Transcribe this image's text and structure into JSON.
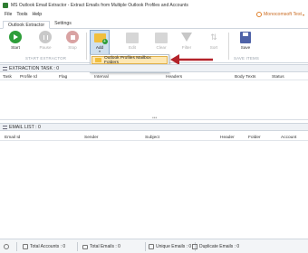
{
  "window": {
    "title": "MS Outlook Email Extractor - Extract Emails from Multiple Outlook Profiles and Accounts"
  },
  "menu": {
    "items": [
      "File",
      "Tools",
      "Help"
    ]
  },
  "account": {
    "label": "Monocomsoft Test",
    "icon": "user-icon"
  },
  "tabs": [
    "Outlook Extractor",
    "Settings"
  ],
  "ribbon": {
    "start": "Start",
    "pause": "Pause",
    "stop": "Stop",
    "add": "Add",
    "edit": "Edit",
    "clear": "Clear",
    "filter": "Filter",
    "sort": "Sort",
    "save": "Save",
    "group_start": "START EXTRACTOR",
    "group_save": "SAVE ITEMS"
  },
  "add_menu": {
    "items": [
      "Outlook Profiles Mailbox Folders",
      "PST Files Mailbox Folders"
    ],
    "highlighted_index": 0
  },
  "task_panel": {
    "title": "EXTRACTION TASK : 0",
    "columns": [
      "Task",
      "Profile Id",
      "Flag",
      "Interval",
      "Headers",
      "Body Texts",
      "Status"
    ]
  },
  "email_panel": {
    "title": "EMAIL LIST : 0",
    "columns": [
      "Email Id",
      "Sender",
      "Subject",
      "Header",
      "Folder",
      "Account"
    ]
  },
  "status": {
    "total_accounts": "Total Accounts : 0",
    "total_emails": "Total Emails : 0",
    "unique_emails": "Unique Emails : 0",
    "duplicate_emails": "Duplicate Emails : 0"
  },
  "colors": {
    "accent": "#2e9e3a",
    "arrow": "#b4232a",
    "highlight": "#fde7b3"
  }
}
